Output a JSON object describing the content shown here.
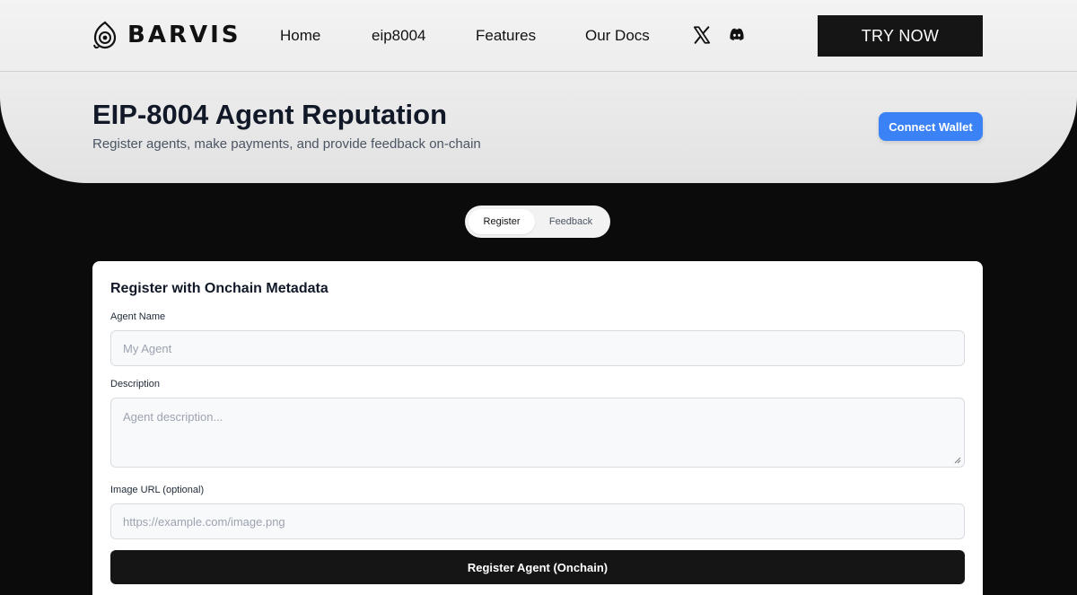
{
  "nav": {
    "brand": "BARVIS",
    "links": [
      "Home",
      "eip8004",
      "Features",
      "Our Docs"
    ],
    "social": [
      "x-icon",
      "discord-icon"
    ],
    "cta": "TRY NOW"
  },
  "header": {
    "title": "EIP-8004 Agent Reputation",
    "subtitle": "Register agents, make payments, and provide feedback on-chain",
    "connect_wallet": "Connect Wallet"
  },
  "tabs": [
    {
      "label": "Register",
      "active": true
    },
    {
      "label": "Feedback",
      "active": false
    }
  ],
  "form": {
    "title": "Register with Onchain Metadata",
    "agent_name": {
      "label": "Agent Name",
      "placeholder": "My Agent",
      "value": ""
    },
    "description": {
      "label": "Description",
      "placeholder": "Agent description...",
      "value": ""
    },
    "image_url": {
      "label": "Image URL (optional)",
      "placeholder": "https://example.com/image.png",
      "value": ""
    },
    "submit": "Register Agent (Onchain)"
  },
  "colors": {
    "accent": "#3b82f6",
    "dark": "#151515",
    "background": "#0b0b0b"
  }
}
